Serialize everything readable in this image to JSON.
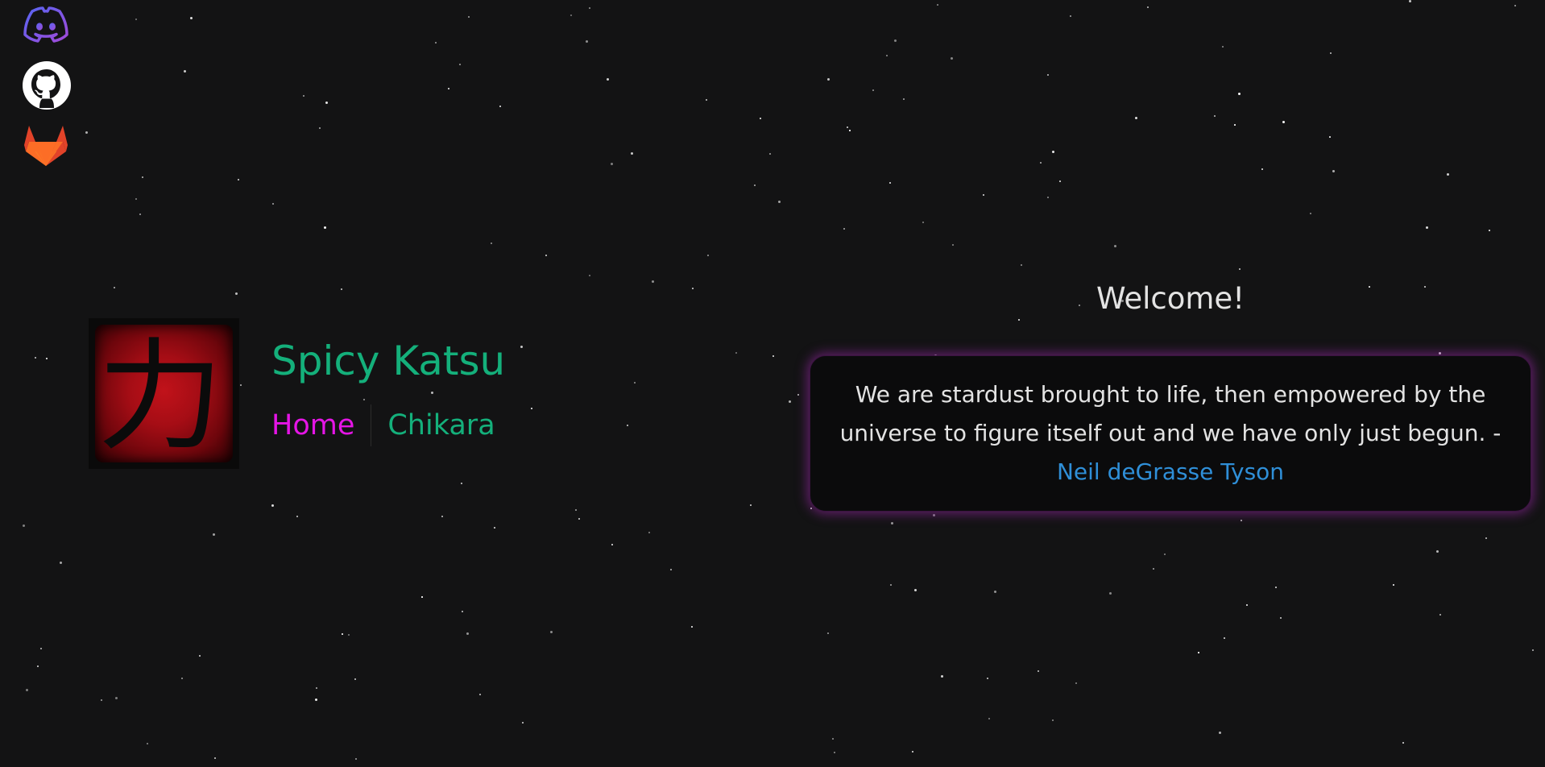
{
  "social": {
    "discord_icon": "discord-icon",
    "github_icon": "github-icon",
    "gitlab_icon": "gitlab-icon"
  },
  "header": {
    "logo_glyph": "力",
    "title": "Spicy Katsu",
    "nav": {
      "home_label": "Home",
      "chikara_label": "Chikara"
    }
  },
  "main": {
    "welcome": "Welcome!",
    "quote": {
      "text": "We are stardust brought to life, then empowered by the universe to figure itself out and we have only just begun. -",
      "author": "Neil deGrasse Tyson"
    }
  },
  "colors": {
    "background": "#131314",
    "title_green": "#14b07b",
    "home_magenta": "#e515e6",
    "author_blue": "#2f8fd8",
    "card_glow": "#a028af",
    "discord_purple": "#6f5bd9",
    "gitlab_orange": "#fc6d26"
  }
}
